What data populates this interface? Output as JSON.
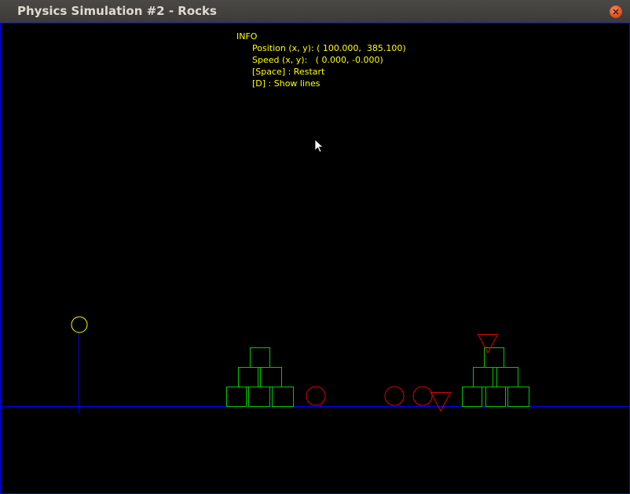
{
  "window": {
    "title": "Physics Simulation #2 - Rocks",
    "close_glyph": "×"
  },
  "info": {
    "heading": "INFO",
    "position_line": "Position (x, y): ( 100.000,  385.100)",
    "speed_line": "Speed (x, y):   ( 0.000, -0.000)",
    "restart_line": "[Space] : Restart",
    "lines_line": "[D] : Show lines"
  },
  "colors": {
    "background": "#000000",
    "border": "#0000ff",
    "ground": "#0000ff",
    "boxes": "#00c800",
    "rocks": "#e00000",
    "player": "#ffff00",
    "text": "#ffff00"
  }
}
